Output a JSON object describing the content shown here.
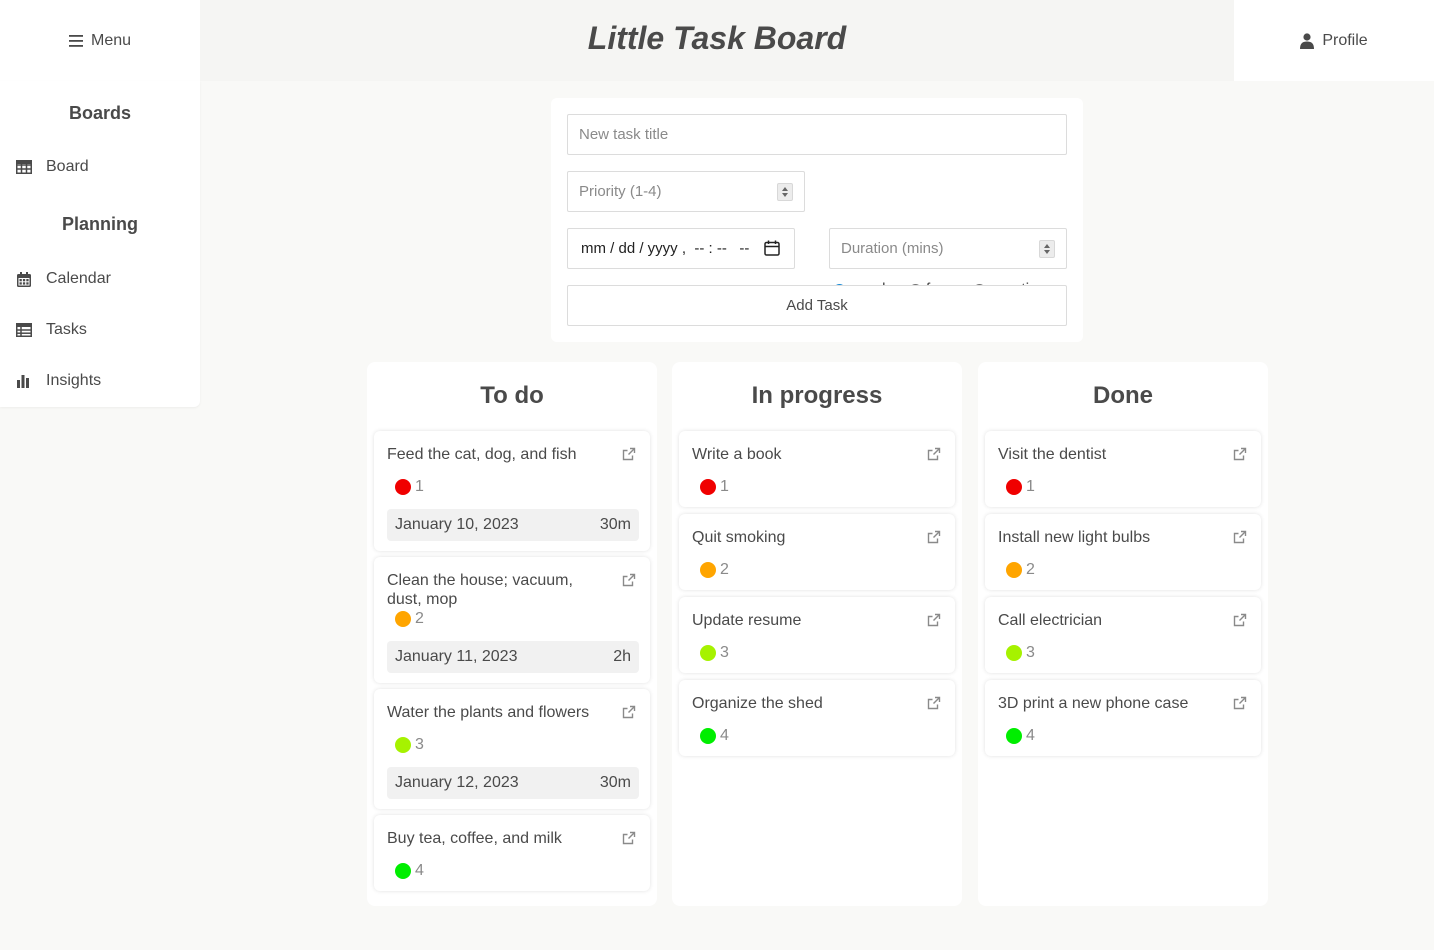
{
  "app_title": "Little Task Board",
  "header": {
    "menu_label": "Menu",
    "profile_label": "Profile"
  },
  "sidebar": {
    "sections": [
      {
        "heading": "Boards",
        "items": [
          {
            "label": "Board",
            "icon": "table-icon"
          }
        ]
      },
      {
        "heading": "Planning",
        "items": [
          {
            "label": "Calendar",
            "icon": "calendar-icon"
          },
          {
            "label": "Tasks",
            "icon": "list-icon"
          },
          {
            "label": "Insights",
            "icon": "bar-chart-icon"
          }
        ]
      }
    ]
  },
  "form": {
    "title_placeholder": "New task title",
    "priority_placeholder": "Priority (1-4)",
    "types": [
      "regular",
      "focus",
      "meeting"
    ],
    "selected_type": "regular",
    "datetime_placeholder": "mm / dd / yyyy ,  -- : --   --",
    "duration_placeholder": "Duration (mins)",
    "add_label": "Add Task"
  },
  "priority_colors": {
    "1": "#f00000",
    "2": "#ffa500",
    "3": "#a6f200",
    "4": "#00ee00"
  },
  "columns": [
    {
      "title": "To do",
      "cards": [
        {
          "title": "Feed the cat, dog, and fish",
          "priority": "1",
          "due": "January 10, 2023",
          "duration": "30m"
        },
        {
          "title": "Clean the house; vacuum, dust, mop",
          "priority": "2",
          "due": "January 11, 2023",
          "duration": "2h"
        },
        {
          "title": "Water the plants and flowers",
          "priority": "3",
          "due": "January 12, 2023",
          "duration": "30m"
        },
        {
          "title": "Buy tea, coffee, and milk",
          "priority": "4"
        }
      ]
    },
    {
      "title": "In progress",
      "cards": [
        {
          "title": "Write a book",
          "priority": "1"
        },
        {
          "title": "Quit smoking",
          "priority": "2"
        },
        {
          "title": "Update resume",
          "priority": "3"
        },
        {
          "title": "Organize the shed",
          "priority": "4"
        }
      ]
    },
    {
      "title": "Done",
      "cards": [
        {
          "title": "Visit the dentist",
          "priority": "1"
        },
        {
          "title": "Install new light bulbs",
          "priority": "2"
        },
        {
          "title": "Call electrician",
          "priority": "3"
        },
        {
          "title": "3D print a new phone case",
          "priority": "4"
        }
      ]
    }
  ]
}
